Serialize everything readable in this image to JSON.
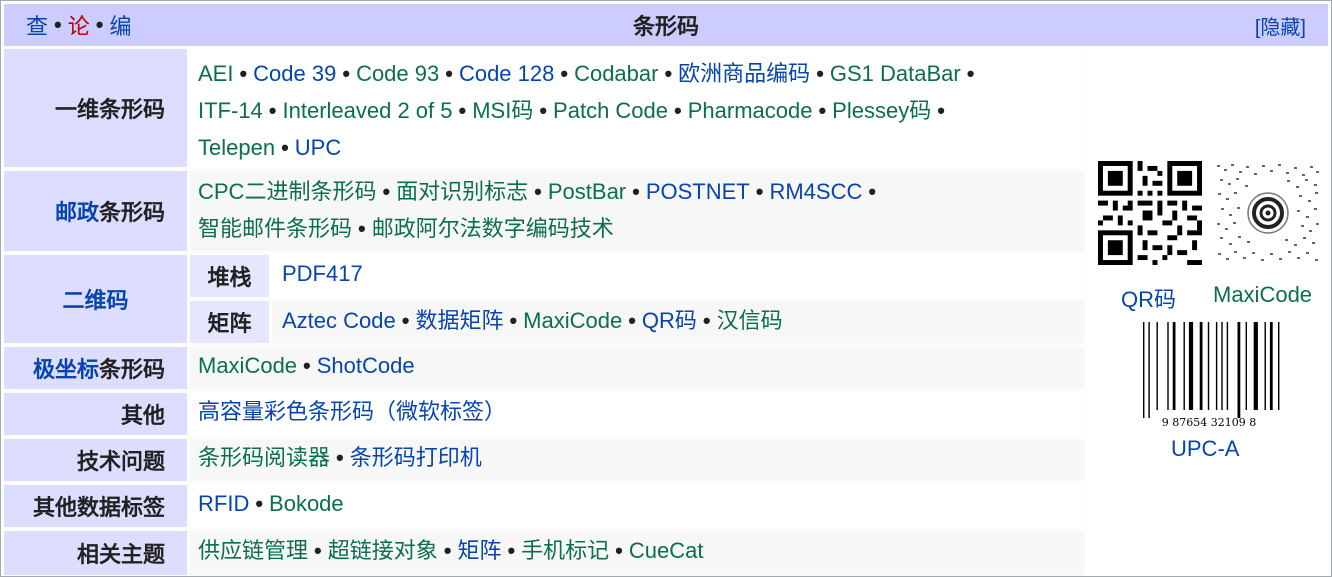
{
  "header": {
    "vte": [
      "查",
      "论",
      "编"
    ],
    "title": "条形码",
    "hide_label": "[隐藏]"
  },
  "groups": [
    {
      "label": "一维条形码",
      "items": [
        "AEI",
        "Code 39",
        "Code 93",
        "Code 128",
        "Codabar",
        "欧洲商品编码",
        "GS1 DataBar",
        "ITF-14",
        "Interleaved 2 of 5",
        "MSI码",
        "Patch Code",
        "Pharmacode",
        "Plessey码",
        "Telepen",
        "UPC"
      ]
    },
    {
      "label_link": "邮政",
      "label_rest": "条形码",
      "items": [
        "CPC二进制条形码",
        "面对识别标志",
        "PostBar",
        "POSTNET",
        "RM4SCC",
        "智能邮件条形码",
        "邮政阿尔法数字编码技术"
      ]
    },
    {
      "label": "二维码",
      "sub": [
        {
          "label": "堆栈",
          "items": [
            "PDF417"
          ]
        },
        {
          "label": "矩阵",
          "items": [
            "Aztec Code",
            "数据矩阵",
            "MaxiCode",
            "QR码",
            "汉信码"
          ]
        }
      ]
    },
    {
      "label_link": "极坐标",
      "label_rest": "条形码",
      "items": [
        "MaxiCode",
        "ShotCode"
      ]
    },
    {
      "label": "其他",
      "items": [
        "高容量彩色条形码（微软标签）"
      ]
    },
    {
      "label": "技术问题",
      "items": [
        "条形码阅读器",
        "条形码打印机"
      ]
    },
    {
      "label": "其他数据标签",
      "items": [
        "RFID",
        "Bokode"
      ]
    },
    {
      "label": "相关主题",
      "items": [
        "供应链管理",
        "超链接对象",
        "矩阵",
        "手机标记",
        "CueCat"
      ]
    }
  ],
  "images": {
    "qr_caption": "QR码",
    "maxicode_caption": "MaxiCode",
    "upc_caption": "UPC-A",
    "upc_digits": "9   87654 32109   8"
  }
}
